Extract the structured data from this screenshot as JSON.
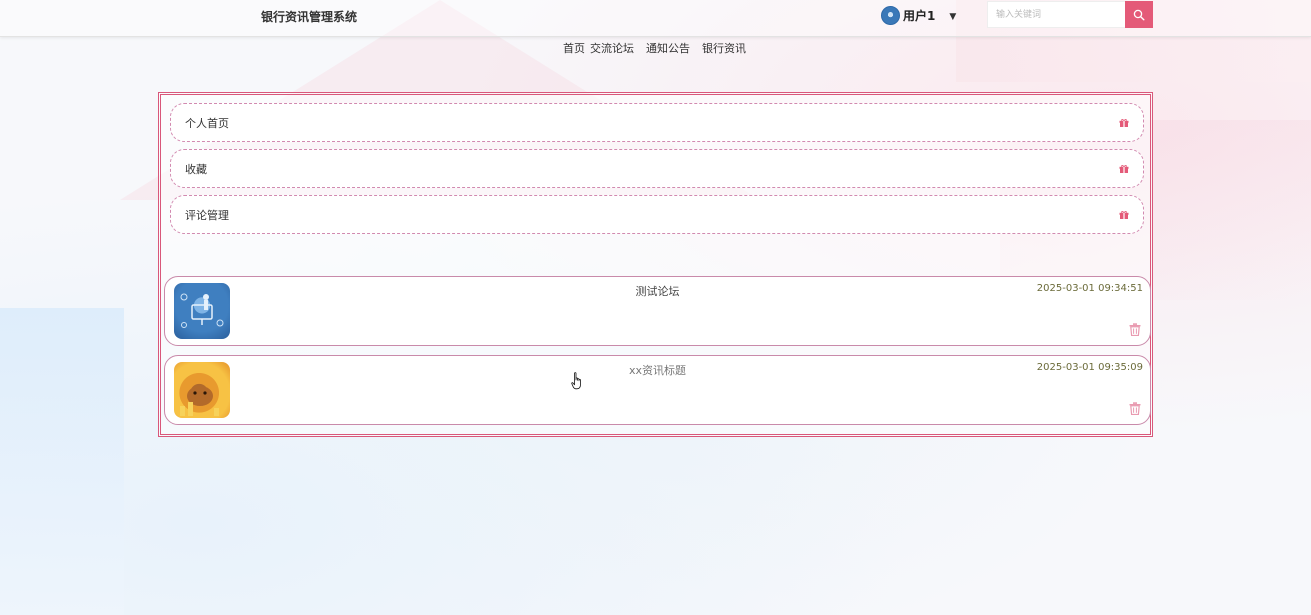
{
  "header": {
    "site_title": "银行资讯管理系统",
    "user_name": "用户1",
    "search_placeholder": "输入关键词"
  },
  "nav": [
    "首页",
    "交流论坛",
    "通知公告",
    "银行资讯"
  ],
  "menu": [
    {
      "label": "个人首页"
    },
    {
      "label": "收藏"
    },
    {
      "label": "评论管理"
    }
  ],
  "favorites": [
    {
      "title": "测试论坛",
      "time": "2025-03-01 09:34:51",
      "thumb": "tech-illustration"
    },
    {
      "title": "xx资讯标题",
      "time": "2025-03-01 09:35:09",
      "thumb": "coins-hamster"
    }
  ],
  "colors": {
    "accent": "#e45a78",
    "panel_border": "#d9577a",
    "dashed_border": "#d28ab0",
    "time_text": "#6b6b3a"
  },
  "icons": {
    "search": "search-icon",
    "menu_item": "gift-icon",
    "delete": "trash-icon",
    "dropdown": "caret-down-icon"
  }
}
